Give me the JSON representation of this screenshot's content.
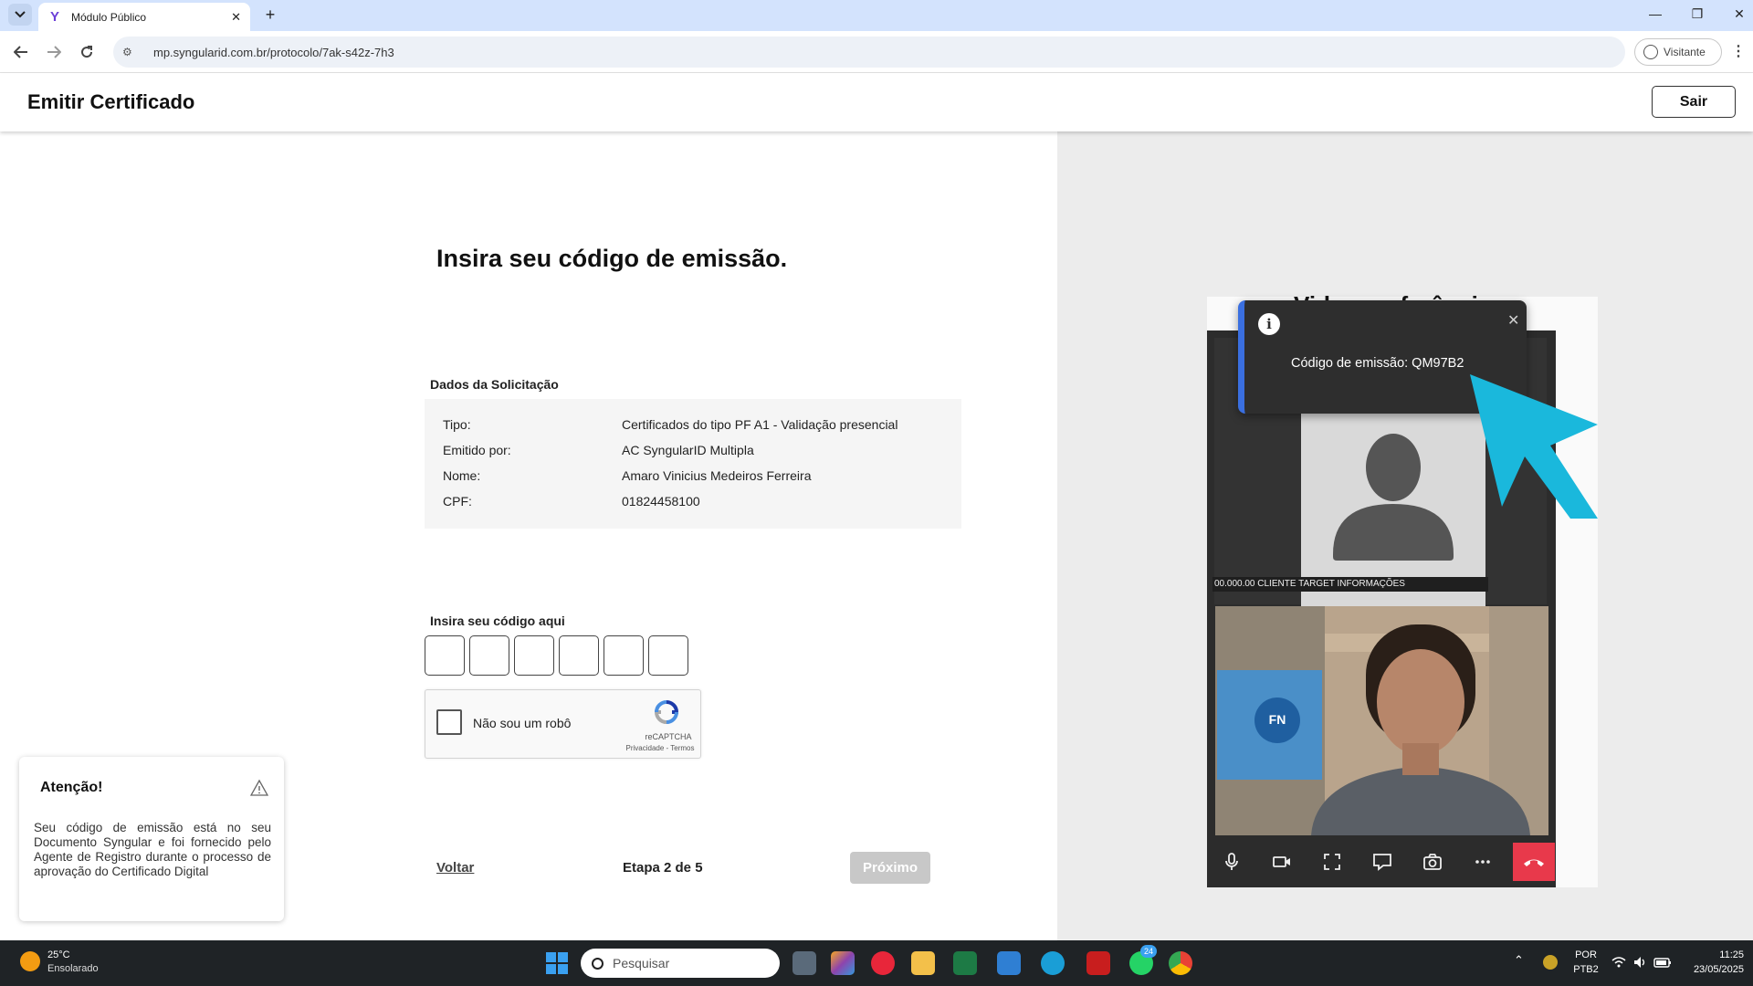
{
  "browser": {
    "tab_title": "Módulo Público",
    "url": "mp.syngularid.com.br/protocolo/7ak-s42z-7h3",
    "profile_label": "Visitante"
  },
  "app": {
    "title": "Emitir Certificado",
    "sair_label": "Sair"
  },
  "main": {
    "heading": "Insira seu código de emissão.",
    "section_label": "Dados da Solicitação",
    "details": [
      {
        "label": "Tipo:",
        "value": "Certificados do tipo PF A1 - Validação presencial"
      },
      {
        "label": "Emitido por:",
        "value": "AC SyngularID Multipla"
      },
      {
        "label": "Nome:",
        "value": "Amaro Vinicius Medeiros Ferreira"
      },
      {
        "label": "CPF:",
        "value": "01824458100"
      }
    ],
    "code_label": "Insira seu código aqui",
    "code_digits": [
      "",
      "",
      "",
      "",
      "",
      ""
    ],
    "recaptcha": {
      "label": "Não sou um robô",
      "brand": "reCAPTCHA",
      "links": "Privacidade - Termos"
    },
    "back_label": "Voltar",
    "step_label": "Etapa 2 de 5",
    "next_label": "Próximo"
  },
  "attention": {
    "title": "Atenção!",
    "text": "Seu código de emissão está no seu Documento Syngular e foi fornecido pelo Agente de Registro durante o processo de aprovação do Certificado Digital"
  },
  "video": {
    "header_partial": "Videoconferência",
    "remote_caption": "00.000.00 CLIENTE TARGET INFORMAÇÕES",
    "toast_text": "Código de emissão: QM97B2"
  },
  "taskbar": {
    "temperature": "25°C",
    "condition": "Ensolarado",
    "search_placeholder": "Pesquisar",
    "lang_top": "POR",
    "lang_bottom": "PTB2",
    "time": "11:25",
    "date": "23/05/2025",
    "whatsapp_badge": "24"
  },
  "colors": {
    "hangup": "#e8394b",
    "arrow": "#1ab8dc",
    "toast_accent": "#3a6fe0",
    "taskbar": "#1f2326"
  }
}
